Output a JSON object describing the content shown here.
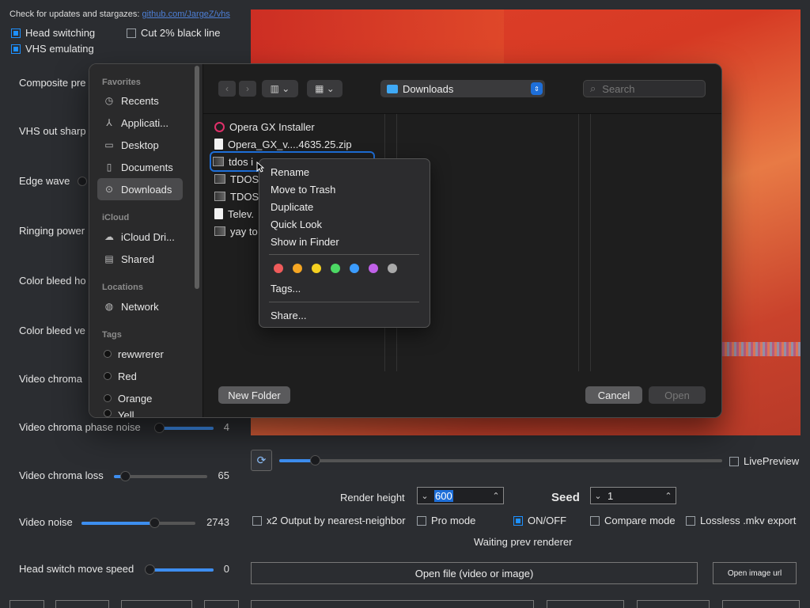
{
  "header": {
    "updates_text": "Check for updates and stargazes:",
    "updates_link": "github.com/JargeZ/vhs"
  },
  "options": {
    "head_switching": "Head switching",
    "cut_black_line": "Cut 2% black line",
    "vhs_emulating": "VHS emulating"
  },
  "params": [
    {
      "label": "Composite pre"
    },
    {
      "label": "VHS out sharp"
    },
    {
      "label": "Edge wave"
    },
    {
      "label": "Ringing power"
    },
    {
      "label": "Color bleed ho"
    },
    {
      "label": "Color bleed ve"
    },
    {
      "label": "Video chroma"
    },
    {
      "label": "Video chroma phase noise",
      "value": "4",
      "level": 0.0
    },
    {
      "label": "Video chroma loss",
      "value": "65",
      "level": 0.06
    },
    {
      "label": "Video noise",
      "value": "2743",
      "level": 0.64
    },
    {
      "label": "Head switch move speed",
      "value": "0",
      "level": 0.0
    }
  ],
  "preview": {
    "timeline_level": 0.08,
    "live_preview": "LivePreview"
  },
  "render": {
    "height_label": "Render height",
    "height_value": "600",
    "seed_label": "Seed",
    "seed_value": "1",
    "x2_output": "x2 Output by nearest-neighbor",
    "pro_mode": "Pro mode",
    "on_off": "ON/OFF",
    "compare_mode": "Compare mode",
    "lossless": "Lossless .mkv export",
    "status": "Waiting prev renderer",
    "open_file": "Open file (video or image)",
    "open_url": "Open image url"
  },
  "dialog": {
    "sidebar": {
      "favorites_header": "Favorites",
      "favorites": [
        "Recents",
        "Applicati...",
        "Desktop",
        "Documents",
        "Downloads"
      ],
      "icloud_header": "iCloud",
      "icloud": [
        "iCloud Dri...",
        "Shared"
      ],
      "locations_header": "Locations",
      "locations": [
        "Network"
      ],
      "tags_header": "Tags",
      "tags": [
        "rewwrerer",
        "Red",
        "Orange",
        "Yell"
      ]
    },
    "path": "Downloads",
    "search_placeholder": "Search",
    "files": [
      "Opera GX Installer",
      "Opera_GX_v....4635.25.zip",
      "tdos i",
      "TDOS",
      "TDOS",
      "Telev.",
      "yay to"
    ],
    "new_folder": "New Folder",
    "cancel": "Cancel",
    "open": "Open"
  },
  "context_menu": {
    "items": [
      "Rename",
      "Move to Trash",
      "Duplicate",
      "Quick Look",
      "Show in Finder"
    ],
    "tag_colors": [
      "#ef5b5b",
      "#f5a623",
      "#f5d020",
      "#4cd964",
      "#3b9cff",
      "#c061e8",
      "#a9a9a9"
    ],
    "tags": "Tags...",
    "share": "Share..."
  }
}
